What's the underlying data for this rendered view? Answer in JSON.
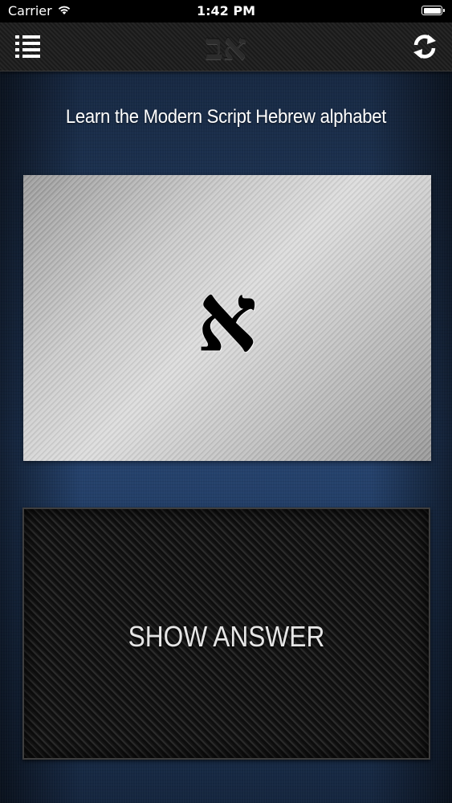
{
  "status_bar": {
    "carrier": "Carrier",
    "time": "1:42 PM"
  },
  "nav_bar": {
    "logo_text": "אב",
    "menu_icon": "list-icon",
    "refresh_icon": "refresh-icon"
  },
  "main": {
    "subtitle": "Learn the Modern Script Hebrew alphabet",
    "current_letter": "א",
    "show_answer_label": "SHOW ANSWER"
  },
  "colors": {
    "background_blue": "#1e3556",
    "nav_dark": "#1f1f1f",
    "text_white": "#ffffff"
  }
}
